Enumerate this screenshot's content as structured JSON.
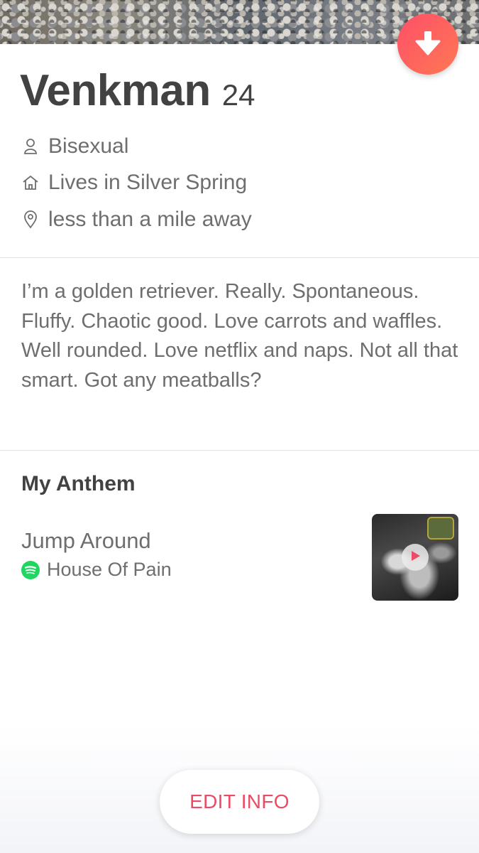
{
  "profile": {
    "name": "Venkman",
    "age": "24",
    "orientation": "Bisexual",
    "residence": "Lives in Silver Spring",
    "distance": "less than a mile away",
    "bio": "I’m a golden retriever. Really. Spontaneous. Fluffy. Chaotic good. Love carrots and waffles. Well rounded. Love netflix and naps. Not all that smart. Got any meatballs?"
  },
  "anthem": {
    "section_title": "My Anthem",
    "song": "Jump Around",
    "artist": "House Of Pain",
    "service_icon": "spotify-icon",
    "album_art": "album-cover-image"
  },
  "icons": {
    "collapse": "arrow-down-icon",
    "orientation": "person-icon",
    "residence": "home-icon",
    "distance": "location-pin-icon",
    "play": "play-icon"
  },
  "actions": {
    "edit_label": "EDIT INFO"
  },
  "colors": {
    "brand_gradient_start": "#fd5068",
    "brand_gradient_end": "#ff7854",
    "edit_text": "#ea4c66",
    "spotify_green": "#1ed760"
  }
}
